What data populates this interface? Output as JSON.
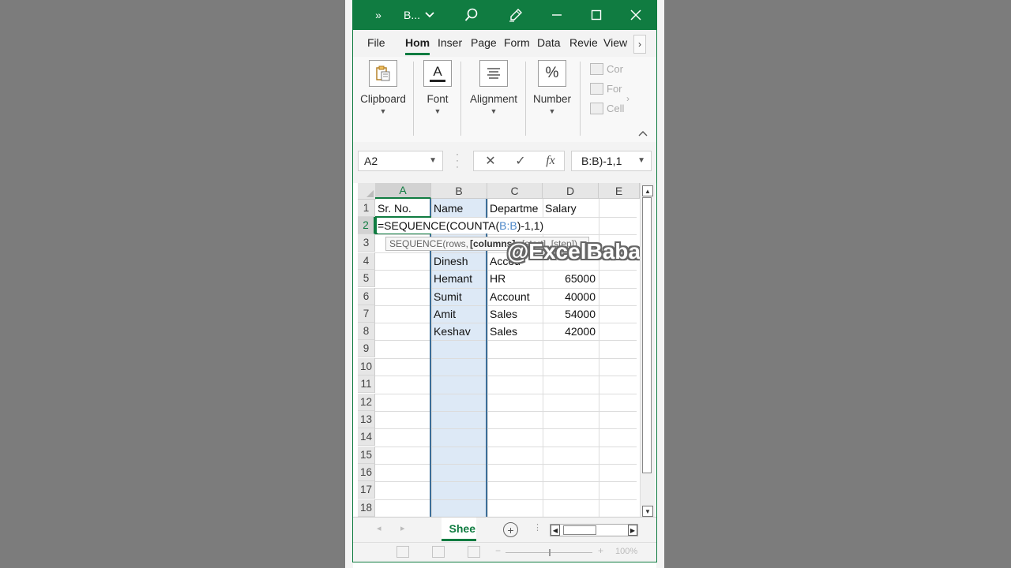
{
  "window": {
    "title": "B...",
    "more_glyph": "»",
    "title_caret": "⌄"
  },
  "tabs": [
    {
      "label": "File"
    },
    {
      "label": "Hom"
    },
    {
      "label": "Inser"
    },
    {
      "label": "Page"
    },
    {
      "label": "Form"
    },
    {
      "label": "Data"
    },
    {
      "label": "Revie"
    },
    {
      "label": "View"
    }
  ],
  "tab_more": "›",
  "ribbon": {
    "groups": [
      {
        "label": "Clipboard",
        "icon": "clipboard-icon"
      },
      {
        "label": "Font",
        "icon": "font-color-icon",
        "glyph": "A"
      },
      {
        "label": "Alignment",
        "icon": "align-icon"
      },
      {
        "label": "Number",
        "icon": "percent-icon",
        "glyph": "%"
      }
    ],
    "styles_items": [
      "Cor",
      "For",
      "Cell"
    ]
  },
  "formula_bar": {
    "name_box": "A2",
    "cancel_glyph": "✕",
    "enter_glyph": "✓",
    "fx_glyph": "fx",
    "value": "B:B)-1,1"
  },
  "columns": [
    "A",
    "B",
    "C",
    "D",
    "E"
  ],
  "rows": [
    "1",
    "2",
    "3",
    "4",
    "5",
    "6",
    "7",
    "8",
    "9",
    "10",
    "11",
    "12",
    "13",
    "14",
    "15",
    "16",
    "17",
    "18"
  ],
  "cells": {
    "r1": {
      "a": "Sr. No.",
      "b": "Name",
      "c": "Departme",
      "d": "Salary"
    },
    "r4": {
      "b": "Dinesh",
      "c": "Accou"
    },
    "r5": {
      "b": "Hemant",
      "c": "HR",
      "d": "65000"
    },
    "r6": {
      "b": "Sumit",
      "c": "Account",
      "d": "40000"
    },
    "r7": {
      "b": "Amit",
      "c": "Sales",
      "d": "54000"
    },
    "r8": {
      "b": "Keshav",
      "c": "Sales",
      "d": "42000"
    }
  },
  "editing": {
    "formula_prefix": "=SEQUENCE(COUNTA(",
    "formula_ref": "B:B",
    "formula_suffix": ")-1,1)",
    "tooltip_prefix": "SEQUENCE(rows,",
    "tooltip_bold": "[columns]",
    "tooltip_suffix": ", [start], [step])"
  },
  "watermark": "@ExcelBaba",
  "sheet_tab": "Shee",
  "add_sheet": "+",
  "status": {
    "zoom": "100%",
    "zoom_minus": "−",
    "zoom_plus": "+"
  },
  "colors": {
    "accent": "#107c41",
    "selection": "#dde9f6",
    "ref_blue": "#4a86c8"
  }
}
